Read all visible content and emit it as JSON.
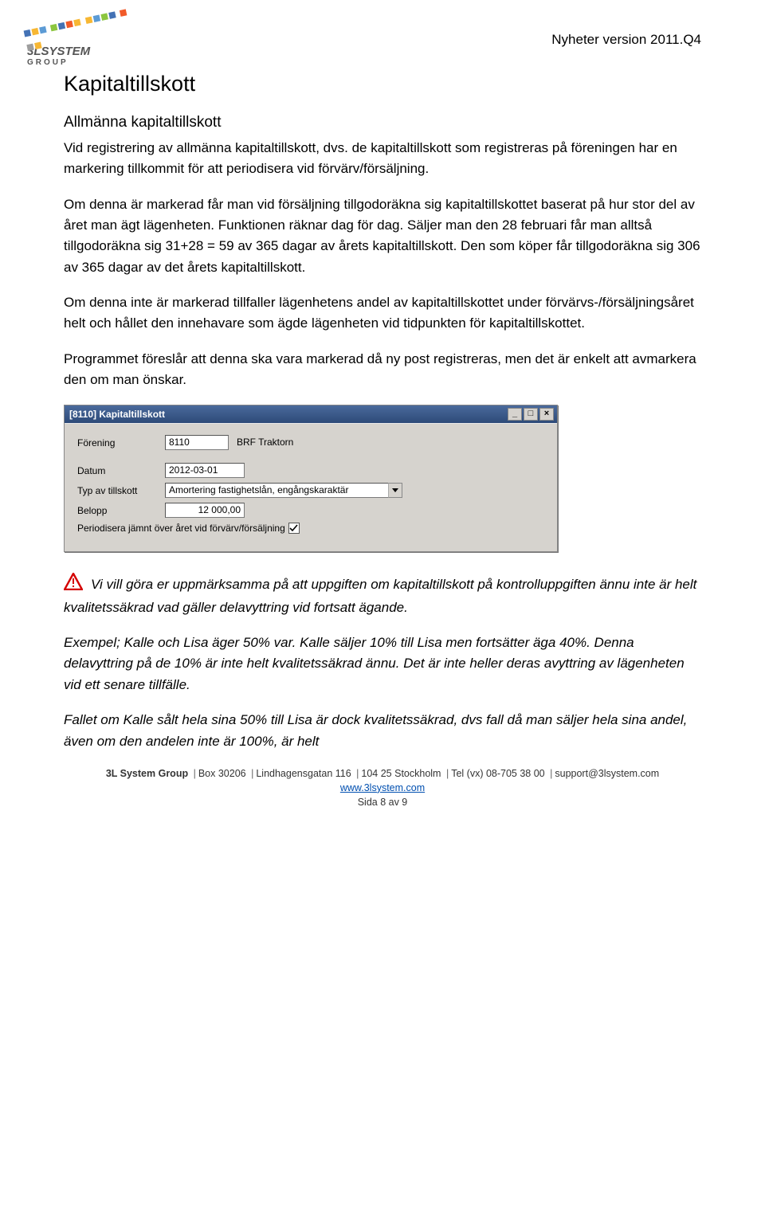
{
  "header": {
    "right": "Nyheter version 2011.Q4",
    "logo_line1": "3LSYSTEM",
    "logo_line2": "GROUP"
  },
  "h1": "Kapitaltillskott",
  "h2": "Allmänna kapitaltillskott",
  "p1": "Vid registrering av allmänna kapitaltillskott, dvs. de kapitaltillskott som registreras på föreningen har en markering tillkommit för att periodisera vid förvärv/försäljning.",
  "p2": "Om denna är markerad får man vid försäljning tillgodoräkna sig kapitaltillskottet baserat på hur stor del av året man ägt lägenheten. Funktionen räknar dag för dag. Säljer man den 28 februari får man alltså tillgodoräkna sig 31+28 = 59 av 365 dagar av årets kapitaltillskott. Den som köper får tillgodoräkna sig 306 av 365 dagar av det årets kapitaltillskott.",
  "p3": "Om denna inte är markerad tillfaller lägenhetens andel av kapitaltillskottet under förvärvs-/försäljningsåret helt och hållet den innehavare som ägde lägenheten vid tidpunkten för kapitaltillskottet.",
  "p4": "Programmet föreslår att denna ska vara markerad då ny post registreras, men det är enkelt att avmarkera den om man önskar.",
  "dialog": {
    "title": "[8110]  Kapitaltillskott",
    "labels": {
      "forening": "Förening",
      "datum": "Datum",
      "typ": "Typ av tillskott",
      "belopp": "Belopp",
      "periodisera": "Periodisera jämnt över året vid förvärv/försäljning"
    },
    "values": {
      "forening_num": "8110",
      "forening_name": "BRF Traktorn",
      "datum": "2012-03-01",
      "typ": "Amortering fastighetslån, engångskaraktär",
      "belopp": "12 000,00",
      "periodisera_checked": true
    }
  },
  "warn_text": "Vi vill göra er uppmärksamma på att uppgiften om kapitaltillskott på kontrolluppgiften ännu inte är helt kvalitetssäkrad vad gäller delavyttring vid fortsatt ägande.",
  "example_text": "Exempel; Kalle och Lisa äger 50% var. Kalle säljer 10% till Lisa men fortsätter äga 40%. Denna delavyttring på de 10% är inte helt kvalitetssäkrad ännu. Det är inte heller deras avyttring av lägenheten vid ett senare tillfälle.",
  "last_text": "Fallet om Kalle sålt hela sina 50% till Lisa är dock kvalitetssäkrad, dvs fall då man säljer hela sina andel, även om den andelen inte är 100%, är helt",
  "footer": {
    "company": "3L System Group",
    "box": "Box 30206",
    "addr": "Lindhagensgatan 116",
    "zip": "104 25 Stockholm",
    "tel": "Tel (vx) 08-705 38 00",
    "email": "support@3lsystem.com",
    "url": "www.3lsystem.com",
    "page": "Sida 8 av 9"
  }
}
